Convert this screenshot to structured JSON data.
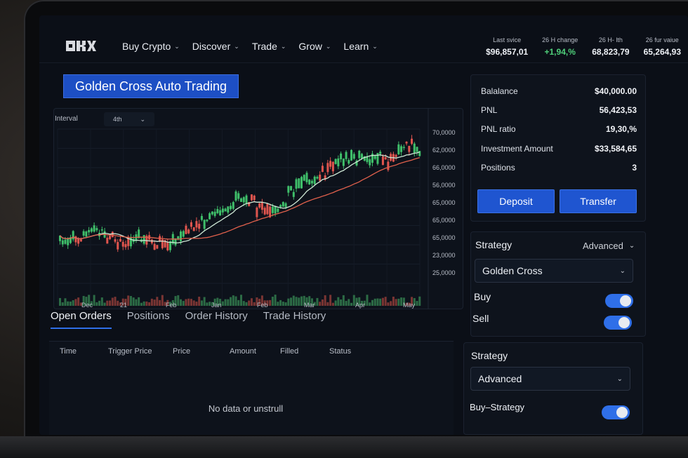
{
  "header": {
    "nav": [
      {
        "label": "Buy Crypto"
      },
      {
        "label": "Discover"
      },
      {
        "label": "Trade"
      },
      {
        "label": "Grow"
      },
      {
        "label": "Learn"
      }
    ],
    "tickers": [
      {
        "label": "Last svice",
        "value": "$96,857,01"
      },
      {
        "label": "26 H change",
        "value": "+1,94,%"
      },
      {
        "label": "26 H- lth",
        "value": "68,823,79"
      },
      {
        "label": "26 fur vaiue",
        "value": "65,264,93"
      }
    ]
  },
  "title": "Golden Cross Auto Trading",
  "chart": {
    "interval_label": "Interval",
    "interval_value": "4th",
    "y_ticks": [
      "70,0000",
      "62,0000",
      "66,0000",
      "56,0000",
      "65,0000",
      "65,0000",
      "65,0000",
      "23,0000",
      "25,0000"
    ],
    "x_ticks": [
      "Dec",
      "21",
      "Feb",
      "Jan",
      "Feb",
      "Mar",
      "Apr",
      "May"
    ]
  },
  "chart_data": {
    "type": "candlestick",
    "series": [
      {
        "name": "price",
        "values": [
          62,
          63,
          62,
          64,
          66,
          65,
          62,
          61,
          60,
          61,
          63,
          62,
          60,
          59,
          60,
          63,
          67,
          70,
          72,
          75,
          76,
          78,
          82,
          83,
          81,
          78,
          77,
          76,
          80,
          86,
          90,
          92,
          93,
          95,
          100,
          102,
          103,
          104,
          106,
          104,
          105,
          102,
          103,
          108,
          110,
          108
        ]
      }
    ]
  },
  "tabs": [
    {
      "label": "Open Orders"
    },
    {
      "label": "Positions"
    },
    {
      "label": "Order History"
    },
    {
      "label": "Trade History"
    }
  ],
  "orders": {
    "columns": [
      "Time",
      "Trigger Price",
      "Price",
      "Amount",
      "Filled",
      "Status"
    ],
    "empty_text": "No data or unstrull"
  },
  "account": {
    "rows": [
      {
        "key": "Balalance",
        "value": "$40,000.00"
      },
      {
        "key": "PNL",
        "value": "56,423,53"
      },
      {
        "key": "PNL ratio",
        "value": "19,30,%"
      },
      {
        "key": "Investment Amount",
        "value": "$33,584,65"
      },
      {
        "key": "Positions",
        "value": "3"
      }
    ],
    "deposit_label": "Deposit",
    "transfer_label": "Transfer"
  },
  "strategy": {
    "title": "Strategy",
    "mode": "Advanced",
    "selected": "Golden Cross",
    "buy_label": "Buy",
    "sell_label": "Sell"
  },
  "strategy2": {
    "title": "Strategy",
    "selected": "Advanced",
    "toggle_label": "Buy–Strategy"
  }
}
